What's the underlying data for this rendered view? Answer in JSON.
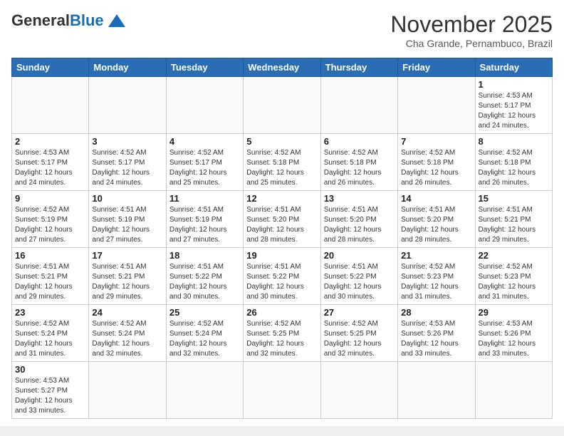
{
  "logo": {
    "general": "General",
    "blue": "Blue"
  },
  "header": {
    "month": "November 2025",
    "location": "Cha Grande, Pernambuco, Brazil"
  },
  "weekdays": [
    "Sunday",
    "Monday",
    "Tuesday",
    "Wednesday",
    "Thursday",
    "Friday",
    "Saturday"
  ],
  "weeks": [
    [
      {
        "day": "",
        "info": ""
      },
      {
        "day": "",
        "info": ""
      },
      {
        "day": "",
        "info": ""
      },
      {
        "day": "",
        "info": ""
      },
      {
        "day": "",
        "info": ""
      },
      {
        "day": "",
        "info": ""
      },
      {
        "day": "1",
        "info": "Sunrise: 4:53 AM\nSunset: 5:17 PM\nDaylight: 12 hours and 24 minutes."
      }
    ],
    [
      {
        "day": "2",
        "info": "Sunrise: 4:53 AM\nSunset: 5:17 PM\nDaylight: 12 hours and 24 minutes."
      },
      {
        "day": "3",
        "info": "Sunrise: 4:52 AM\nSunset: 5:17 PM\nDaylight: 12 hours and 24 minutes."
      },
      {
        "day": "4",
        "info": "Sunrise: 4:52 AM\nSunset: 5:17 PM\nDaylight: 12 hours and 25 minutes."
      },
      {
        "day": "5",
        "info": "Sunrise: 4:52 AM\nSunset: 5:18 PM\nDaylight: 12 hours and 25 minutes."
      },
      {
        "day": "6",
        "info": "Sunrise: 4:52 AM\nSunset: 5:18 PM\nDaylight: 12 hours and 26 minutes."
      },
      {
        "day": "7",
        "info": "Sunrise: 4:52 AM\nSunset: 5:18 PM\nDaylight: 12 hours and 26 minutes."
      },
      {
        "day": "8",
        "info": "Sunrise: 4:52 AM\nSunset: 5:18 PM\nDaylight: 12 hours and 26 minutes."
      }
    ],
    [
      {
        "day": "9",
        "info": "Sunrise: 4:52 AM\nSunset: 5:19 PM\nDaylight: 12 hours and 27 minutes."
      },
      {
        "day": "10",
        "info": "Sunrise: 4:51 AM\nSunset: 5:19 PM\nDaylight: 12 hours and 27 minutes."
      },
      {
        "day": "11",
        "info": "Sunrise: 4:51 AM\nSunset: 5:19 PM\nDaylight: 12 hours and 27 minutes."
      },
      {
        "day": "12",
        "info": "Sunrise: 4:51 AM\nSunset: 5:20 PM\nDaylight: 12 hours and 28 minutes."
      },
      {
        "day": "13",
        "info": "Sunrise: 4:51 AM\nSunset: 5:20 PM\nDaylight: 12 hours and 28 minutes."
      },
      {
        "day": "14",
        "info": "Sunrise: 4:51 AM\nSunset: 5:20 PM\nDaylight: 12 hours and 28 minutes."
      },
      {
        "day": "15",
        "info": "Sunrise: 4:51 AM\nSunset: 5:21 PM\nDaylight: 12 hours and 29 minutes."
      }
    ],
    [
      {
        "day": "16",
        "info": "Sunrise: 4:51 AM\nSunset: 5:21 PM\nDaylight: 12 hours and 29 minutes."
      },
      {
        "day": "17",
        "info": "Sunrise: 4:51 AM\nSunset: 5:21 PM\nDaylight: 12 hours and 29 minutes."
      },
      {
        "day": "18",
        "info": "Sunrise: 4:51 AM\nSunset: 5:22 PM\nDaylight: 12 hours and 30 minutes."
      },
      {
        "day": "19",
        "info": "Sunrise: 4:51 AM\nSunset: 5:22 PM\nDaylight: 12 hours and 30 minutes."
      },
      {
        "day": "20",
        "info": "Sunrise: 4:51 AM\nSunset: 5:22 PM\nDaylight: 12 hours and 30 minutes."
      },
      {
        "day": "21",
        "info": "Sunrise: 4:52 AM\nSunset: 5:23 PM\nDaylight: 12 hours and 31 minutes."
      },
      {
        "day": "22",
        "info": "Sunrise: 4:52 AM\nSunset: 5:23 PM\nDaylight: 12 hours and 31 minutes."
      }
    ],
    [
      {
        "day": "23",
        "info": "Sunrise: 4:52 AM\nSunset: 5:24 PM\nDaylight: 12 hours and 31 minutes."
      },
      {
        "day": "24",
        "info": "Sunrise: 4:52 AM\nSunset: 5:24 PM\nDaylight: 12 hours and 32 minutes."
      },
      {
        "day": "25",
        "info": "Sunrise: 4:52 AM\nSunset: 5:24 PM\nDaylight: 12 hours and 32 minutes."
      },
      {
        "day": "26",
        "info": "Sunrise: 4:52 AM\nSunset: 5:25 PM\nDaylight: 12 hours and 32 minutes."
      },
      {
        "day": "27",
        "info": "Sunrise: 4:52 AM\nSunset: 5:25 PM\nDaylight: 12 hours and 32 minutes."
      },
      {
        "day": "28",
        "info": "Sunrise: 4:53 AM\nSunset: 5:26 PM\nDaylight: 12 hours and 33 minutes."
      },
      {
        "day": "29",
        "info": "Sunrise: 4:53 AM\nSunset: 5:26 PM\nDaylight: 12 hours and 33 minutes."
      }
    ],
    [
      {
        "day": "30",
        "info": "Sunrise: 4:53 AM\nSunset: 5:27 PM\nDaylight: 12 hours and 33 minutes."
      },
      {
        "day": "",
        "info": ""
      },
      {
        "day": "",
        "info": ""
      },
      {
        "day": "",
        "info": ""
      },
      {
        "day": "",
        "info": ""
      },
      {
        "day": "",
        "info": ""
      },
      {
        "day": "",
        "info": ""
      }
    ]
  ]
}
